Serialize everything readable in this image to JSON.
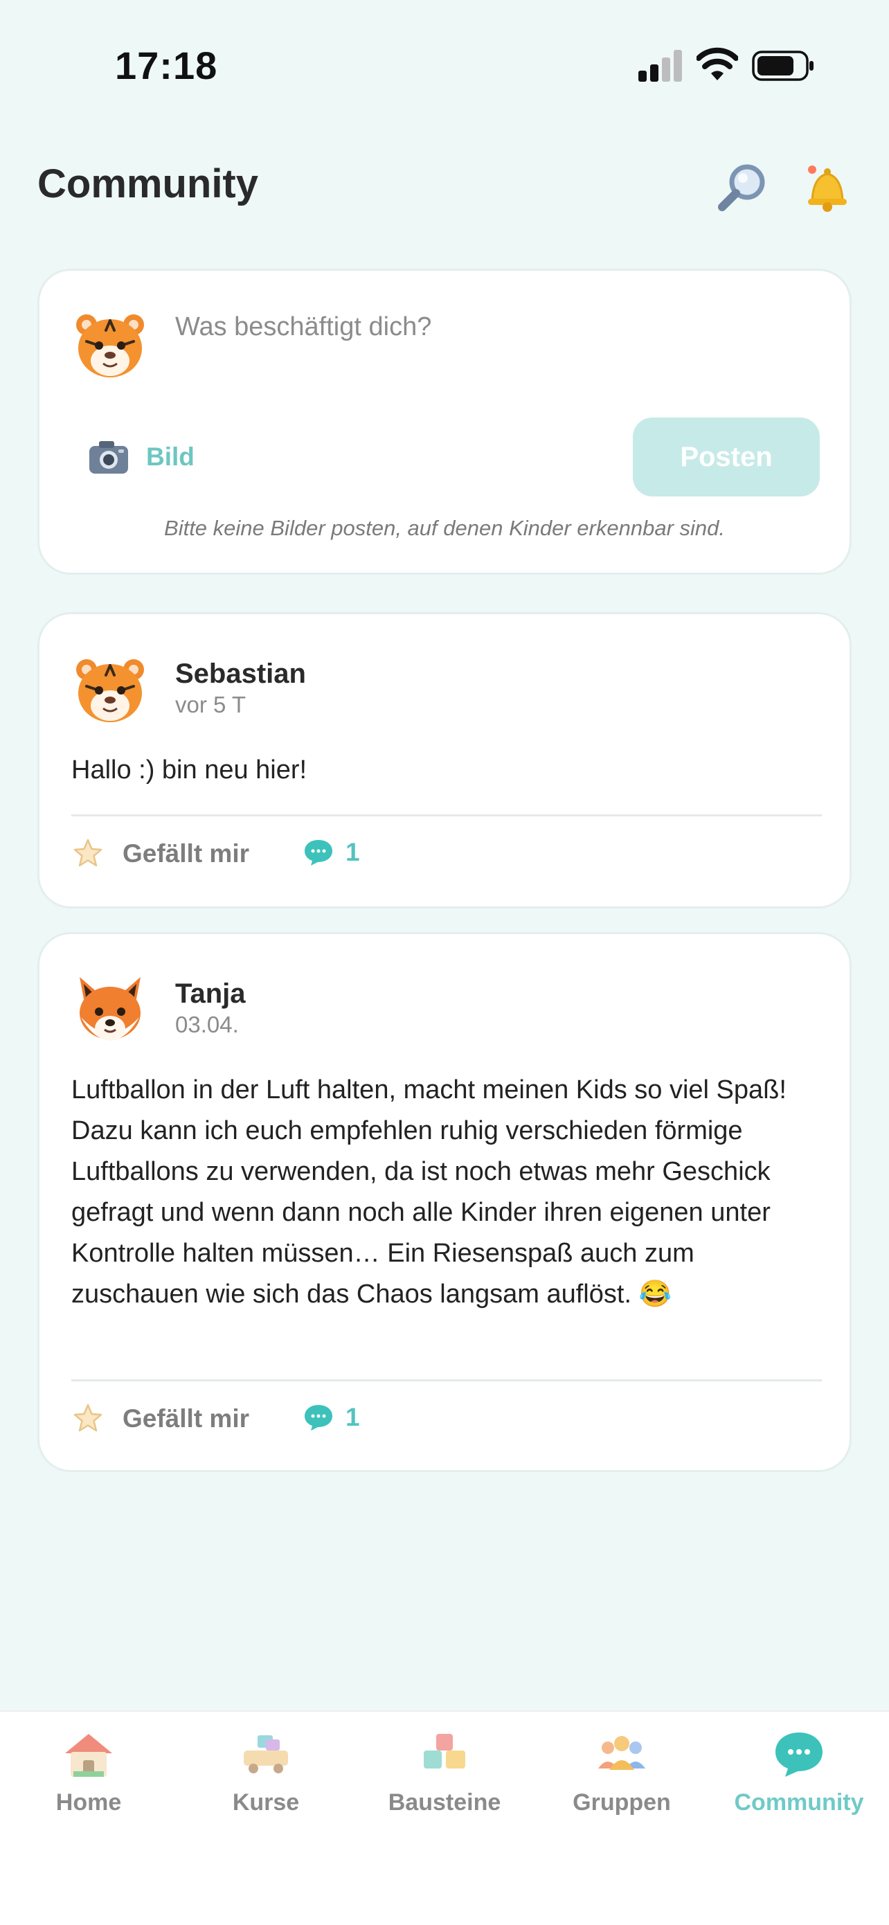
{
  "status_bar": {
    "time": "17:18"
  },
  "header": {
    "title": "Community"
  },
  "composer": {
    "placeholder": "Was beschäftigt dich?",
    "image_label": "Bild",
    "post_label": "Posten",
    "hint": "Bitte keine Bilder posten, auf denen Kinder erkennbar sind."
  },
  "posts": [
    {
      "author": "Sebastian",
      "time": "vor 5 T",
      "text": "Hallo :) bin neu hier!",
      "like_label": "Gefällt mir",
      "comments": "1",
      "avatar": "tiger-avatar"
    },
    {
      "author": "Tanja",
      "time": "03.04.",
      "text": "Luftballon in der Luft halten, macht meinen Kids so viel Spaß! Dazu kann ich euch empfehlen ruhig verschieden förmige Luftballons zu verwenden, da ist noch etwas mehr Geschick gefragt und wenn dann noch alle Kinder ihren eigenen unter Kontrolle halten müssen… Ein Riesenspaß auch zum zuschauen wie sich das Chaos langsam auflöst. 😂",
      "like_label": "Gefällt mir",
      "comments": "1",
      "avatar": "fox-avatar"
    }
  ],
  "tabs": [
    {
      "label": "Home",
      "icon": "house-icon"
    },
    {
      "label": "Kurse",
      "icon": "toy-car-icon"
    },
    {
      "label": "Bausteine",
      "icon": "blocks-icon"
    },
    {
      "label": "Gruppen",
      "icon": "people-icon"
    },
    {
      "label": "Community",
      "icon": "chat-bubble-icon",
      "active": true
    }
  ],
  "colors": {
    "accent": "#6fcac6",
    "background": "#eef8f7",
    "post_button": "#c6eae8"
  }
}
